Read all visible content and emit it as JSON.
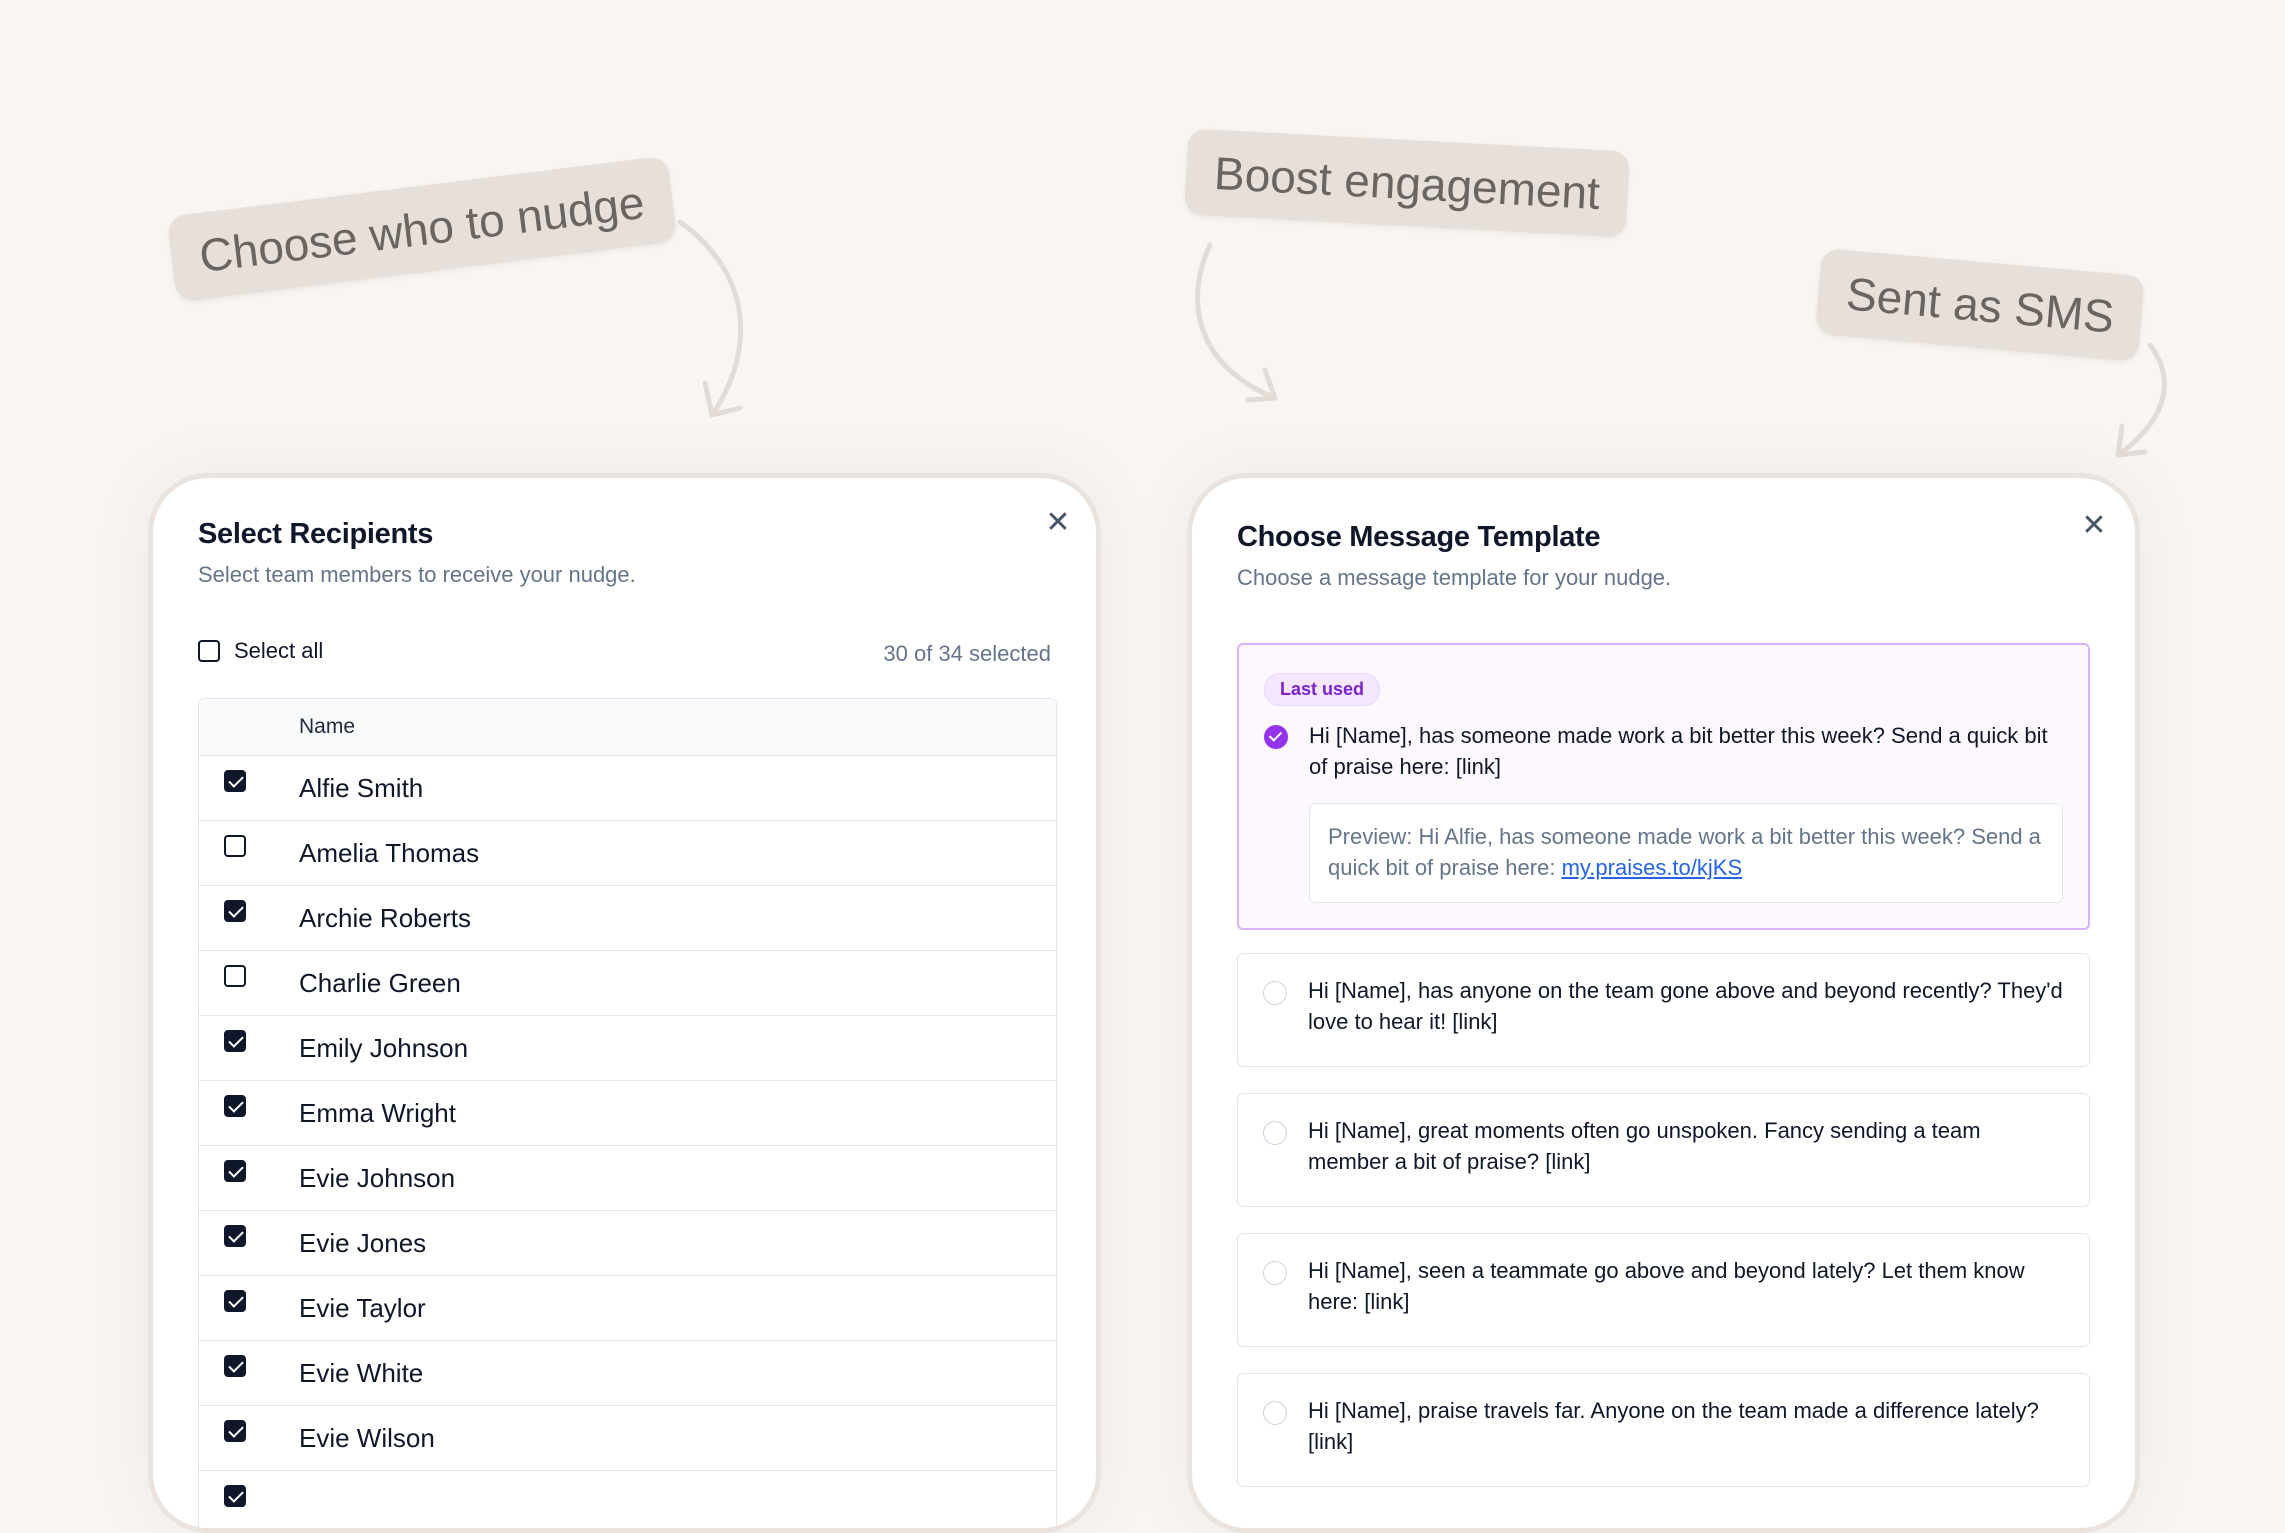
{
  "annotations": {
    "choose_who": "Choose who to nudge",
    "boost": "Boost engagement",
    "sms": "Sent as SMS"
  },
  "recipients": {
    "title": "Select Recipients",
    "subtitle": "Select team members to receive your nudge.",
    "select_all": "Select all",
    "selected_count": "30 of 34 selected",
    "column_name": "Name",
    "close_icon": "close-icon",
    "rows": [
      {
        "name": "Alfie Smith",
        "checked": true
      },
      {
        "name": "Amelia Thomas",
        "checked": false
      },
      {
        "name": "Archie Roberts",
        "checked": true
      },
      {
        "name": "Charlie Green",
        "checked": false
      },
      {
        "name": "Emily Johnson",
        "checked": true
      },
      {
        "name": "Emma Wright",
        "checked": true
      },
      {
        "name": "Evie Johnson",
        "checked": true
      },
      {
        "name": "Evie Jones",
        "checked": true
      },
      {
        "name": "Evie Taylor",
        "checked": true
      },
      {
        "name": "Evie White",
        "checked": true
      },
      {
        "name": "Evie Wilson",
        "checked": true
      },
      {
        "name": "",
        "checked": true
      }
    ]
  },
  "templates": {
    "title": "Choose Message Template",
    "subtitle": "Choose a message template for your nudge.",
    "close_icon": "close-icon",
    "last_used_badge": "Last used",
    "preview_text": "Preview: Hi Alfie, has someone made work a bit better this week? Send a quick bit of praise here:",
    "preview_link": "my.praises.to/kjKS",
    "options": [
      {
        "text": "Hi [Name], has someone made work a bit better this week? Send a quick bit of praise here: [link]",
        "selected": true
      },
      {
        "text": "Hi [Name], has anyone on the team gone above and beyond recently? They'd love to hear it! [link]",
        "selected": false
      },
      {
        "text": "Hi [Name], great moments often go unspoken. Fancy sending a team member a bit of praise? [link]",
        "selected": false
      },
      {
        "text": "Hi [Name], seen a teammate go above and beyond lately? Let them know here: [link]",
        "selected": false
      },
      {
        "text": "Hi [Name], praise travels far. Anyone on the team made a difference lately? [link]",
        "selected": false
      }
    ]
  },
  "colors": {
    "background": "#f9f5f2",
    "label_bg": "#e6dfda",
    "accent_purple": "#9333ea",
    "link_blue": "#2563eb"
  }
}
